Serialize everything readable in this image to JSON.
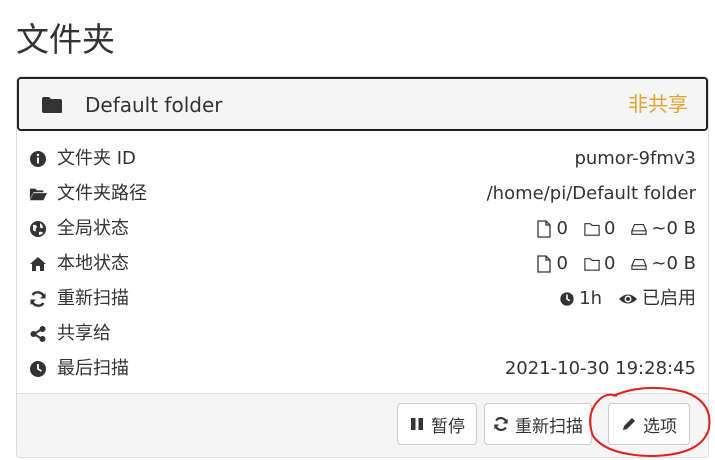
{
  "page": {
    "title": "文件夹"
  },
  "folder": {
    "name": "Default folder",
    "share_status": "非共享",
    "share_status_color": "#e0a52e",
    "icon": "folder-icon"
  },
  "rows": [
    {
      "icon": "info-circle-icon",
      "label": "文件夹 ID",
      "value": "pumor-9fmv3"
    },
    {
      "icon": "folder-open-icon",
      "label": "文件夹路径",
      "value": "/home/pi/Default folder"
    },
    {
      "icon": "globe-icon",
      "label": "全局状态",
      "files": "0",
      "dirs": "0",
      "size": "~0 B"
    },
    {
      "icon": "home-icon",
      "label": "本地状态",
      "files": "0",
      "dirs": "0",
      "size": "~0 B"
    },
    {
      "icon": "refresh-icon",
      "label": "重新扫描",
      "interval": "1h",
      "watch": "已启用"
    },
    {
      "icon": "share-icon",
      "label": "共享给"
    },
    {
      "icon": "clock-icon",
      "label": "最后扫描",
      "value": "2021-10-30 19:28:45"
    }
  ],
  "actions": {
    "pause_label": "暂停",
    "rescan_label": "重新扫描",
    "options_label": "选项"
  },
  "colors": {
    "panel_bg": "#f5f5f5",
    "border": "#dddddd",
    "annotation": "#e02020"
  }
}
